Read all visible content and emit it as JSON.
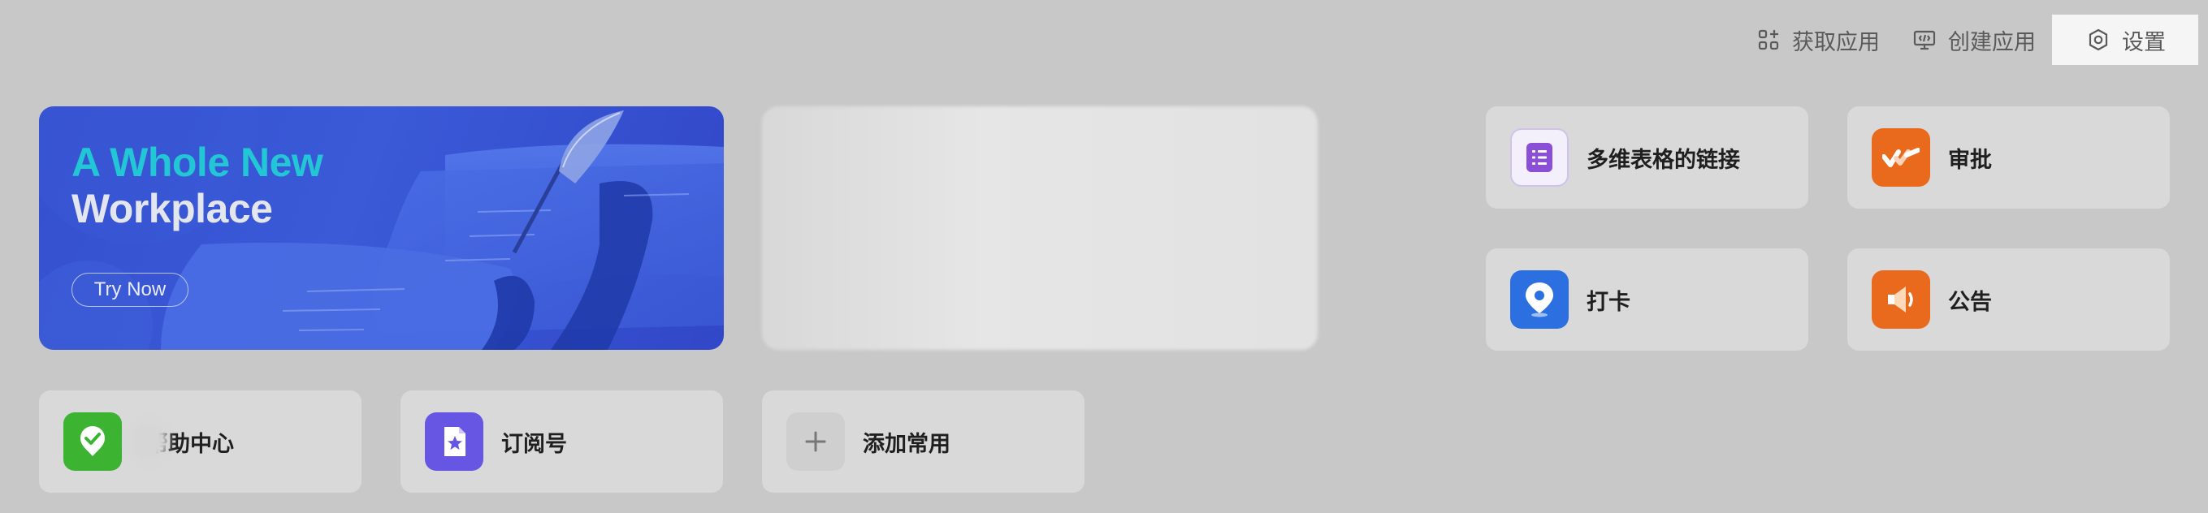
{
  "toolbar": {
    "get_apps": "获取应用",
    "create_app": "创建应用",
    "settings": "设置"
  },
  "banner": {
    "title_line1": "A Whole New",
    "title_line2": "Workplace",
    "cta": "Try Now",
    "colors": {
      "accent": "#22c6d4",
      "background": "#3550cf"
    }
  },
  "apps": {
    "bitable_link": {
      "label": "多维表格的链接",
      "icon": "bitable-icon",
      "color": "#8a4fd6"
    },
    "approval": {
      "label": "审批",
      "icon": "approval-icon",
      "color": "#ea6a1d"
    },
    "checkin": {
      "label": "打卡",
      "icon": "location-pin-icon",
      "color": "#2b6fe0"
    },
    "announcement": {
      "label": "公告",
      "icon": "megaphone-icon",
      "color": "#ea6a1d"
    },
    "help_center": {
      "label": "帮助中心",
      "icon": "help-shield-icon",
      "color": "#3cb432"
    },
    "subscription": {
      "label": "订阅号",
      "icon": "subscription-star-icon",
      "color": "#6656e3"
    },
    "add_favorite": {
      "label": "添加常用",
      "icon": "plus-icon"
    }
  }
}
